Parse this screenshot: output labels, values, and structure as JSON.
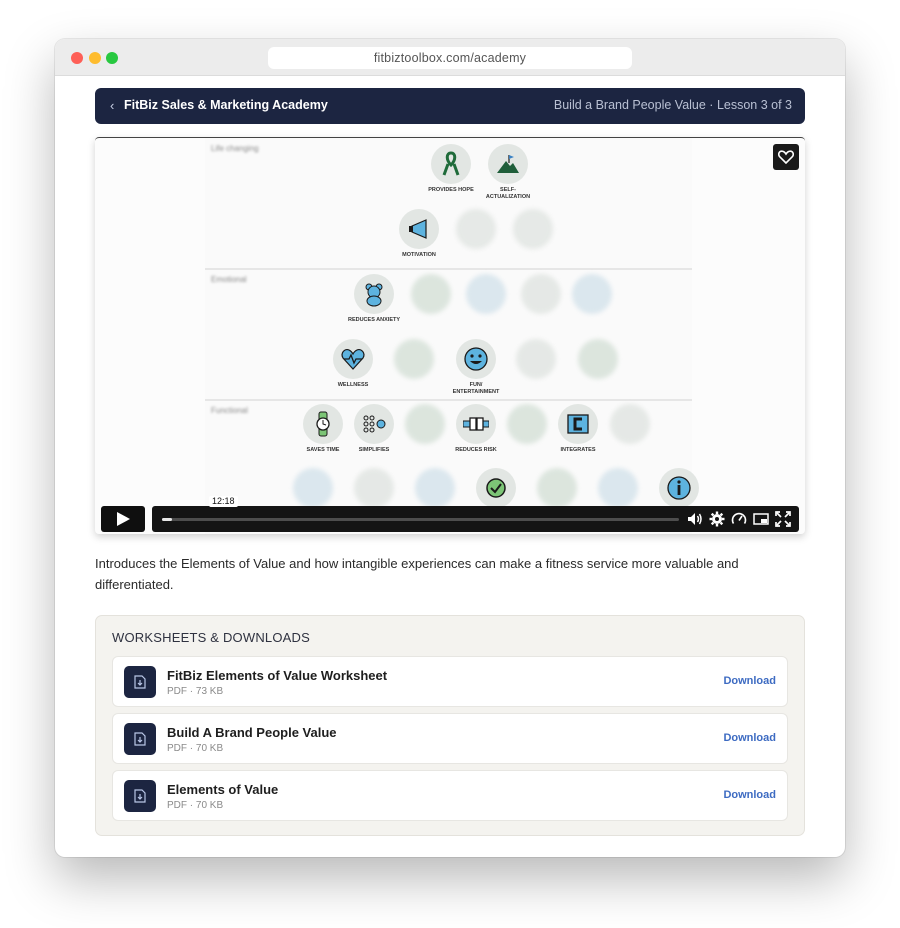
{
  "browser": {
    "url": "fitbiztoolbox.com/academy"
  },
  "header": {
    "back_icon": "chevron-left-icon",
    "course_title": "FitBiz Sales & Marketing Academy",
    "lesson_breadcrumb": "Build a Brand People Value · Lesson 3 of 3"
  },
  "video": {
    "current_time": "12:18",
    "progress": 0.02,
    "favorite_icon": "heart-icon",
    "slide_labels": {
      "provides_hope": "PROVIDES HOPE",
      "self_actualization": "SELF- ACTUALIZATION",
      "motivation": "MOTIVATION",
      "reduces_anxiety": "REDUCES ANXIETY",
      "wellness": "WELLNESS",
      "fun_entertainment": "FUN/ ENTERTAINMENT",
      "saves_time": "SAVES TIME",
      "simplifies": "SIMPLIFIES",
      "reduces_risk": "REDUCES RISK",
      "integrates": "INTEGRATES"
    },
    "controls": {
      "play_icon": "play-icon",
      "volume_icon": "volume-icon",
      "settings_icon": "gear-icon",
      "speed_icon": "speed-icon",
      "pip_icon": "picture-in-picture-icon",
      "fullscreen_icon": "fullscreen-icon"
    }
  },
  "lesson": {
    "description": "Introduces the Elements of Value and how intangible experiences can make a fitness service more valuable and differentiated."
  },
  "downloads": {
    "heading": "WORKSHEETS & DOWNLOADS",
    "items": [
      {
        "name": "FitBiz Elements of Value Worksheet",
        "meta": "PDF · 73 KB",
        "action": "Download"
      },
      {
        "name": "Build A Brand People Value",
        "meta": "PDF · 70 KB",
        "action": "Download"
      },
      {
        "name": "Elements of Value",
        "meta": "PDF · 70 KB",
        "action": "Download"
      }
    ]
  },
  "colors": {
    "header_bg": "#1c2541",
    "accent_link": "#3d6bc2",
    "panel_bg": "#f4f3ef"
  }
}
